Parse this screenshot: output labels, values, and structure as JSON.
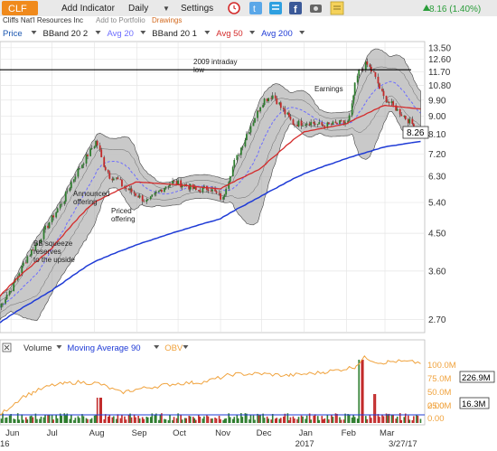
{
  "toolbar": {
    "ticker": "CLF",
    "add_indicator": "Add Indicator",
    "interval": "Daily",
    "settings": "Settings",
    "right_text": "8.16 (1.40%)",
    "colors": {
      "bg": "#e9e9e9",
      "ticker_bg": "#f08a1c",
      "green": "#2a9d3a"
    }
  },
  "subbar": {
    "company": "Cliffs Nat'l Resources Inc",
    "add_to_portfolio": "Add to Portfolio",
    "drawings": "Drawings"
  },
  "legend": {
    "items": [
      {
        "label": "Price",
        "color": "#1a56b0"
      },
      {
        "label": "BBand 20 2",
        "color": "#222222"
      },
      {
        "label": "Avg 20",
        "color": "#6d6dff"
      },
      {
        "label": "BBand 20 1",
        "color": "#222222"
      },
      {
        "label": "Avg 50",
        "color": "#d42b2b"
      },
      {
        "label": "Avg 200",
        "color": "#1f3bd6"
      }
    ]
  },
  "annotations": {
    "intraday": "2009 intraday\nlow",
    "earnings": "Earnings",
    "announced": "Announced\noffering",
    "priced": "Priced\noffering",
    "bb_squeeze": "BB squeeze\nreserves\nto the upside"
  },
  "chart_data": [
    {
      "type": "candlestick",
      "title": "CLF",
      "y_scale": "log",
      "ylim": [
        2.5,
        14.0
      ],
      "y_ticks": [
        "13.50",
        "12.60",
        "11.70",
        "10.80",
        "9.90",
        "9.00",
        "8.10",
        "7.20",
        "6.30",
        "5.40",
        "4.50",
        "3.60",
        "2.70"
      ],
      "y_tick_values": [
        13.5,
        12.6,
        11.7,
        10.8,
        9.9,
        9.0,
        8.1,
        7.2,
        6.3,
        5.4,
        4.5,
        3.6,
        2.7
      ],
      "x_tick_labels": [
        "Jun",
        "Jul",
        "Aug",
        "Sep",
        "Oct",
        "Nov",
        "Dec",
        "Jan",
        "Feb",
        "Mar"
      ],
      "x_tick_dates": [
        "2016-06-01",
        "2016-07-01",
        "2016-08-01",
        "2016-09-01",
        "2016-10-01",
        "2016-11-01",
        "2016-12-01",
        "2017-01-01",
        "2017-02-01",
        "2017-03-01"
      ],
      "x_range": [
        "2016-05-24",
        "2017-03-30"
      ],
      "year_labels": [
        "16",
        "2017"
      ],
      "end_date_label": "3/27/17",
      "last_price_label": "8.26",
      "last_price": 8.26,
      "horizontal_line": 11.85,
      "price_path": [
        [
          "2016-05-24",
          2.9
        ],
        [
          "2016-06-03",
          3.3
        ],
        [
          "2016-06-13",
          3.9
        ],
        [
          "2016-06-22",
          4.3
        ],
        [
          "2016-07-01",
          4.9
        ],
        [
          "2016-07-10",
          5.5
        ],
        [
          "2016-07-20",
          6.5
        ],
        [
          "2016-07-29",
          7.3
        ],
        [
          "2016-08-03",
          7.8
        ],
        [
          "2016-08-08",
          6.8
        ],
        [
          "2016-08-13",
          6.3
        ],
        [
          "2016-08-18",
          6.2
        ],
        [
          "2016-08-23",
          5.9
        ],
        [
          "2016-08-31",
          5.7
        ],
        [
          "2016-09-09",
          5.4
        ],
        [
          "2016-09-18",
          5.8
        ],
        [
          "2016-09-27",
          6.1
        ],
        [
          "2016-10-06",
          6.0
        ],
        [
          "2016-10-15",
          5.8
        ],
        [
          "2016-10-24",
          5.9
        ],
        [
          "2016-11-03",
          5.5
        ],
        [
          "2016-11-10",
          6.6
        ],
        [
          "2016-11-18",
          7.7
        ],
        [
          "2016-11-26",
          8.9
        ],
        [
          "2016-12-03",
          9.9
        ],
        [
          "2016-12-10",
          10.2
        ],
        [
          "2016-12-17",
          9.3
        ],
        [
          "2016-12-25",
          8.6
        ],
        [
          "2017-01-05",
          8.7
        ],
        [
          "2017-01-15",
          8.5
        ],
        [
          "2017-01-25",
          8.6
        ],
        [
          "2017-02-03",
          8.7
        ],
        [
          "2017-02-10",
          11.6
        ],
        [
          "2017-02-16",
          12.3
        ],
        [
          "2017-02-21",
          11.6
        ],
        [
          "2017-02-28",
          10.1
        ],
        [
          "2017-03-07",
          9.6
        ],
        [
          "2017-03-14",
          9.1
        ],
        [
          "2017-03-21",
          8.6
        ],
        [
          "2017-03-27",
          8.26
        ]
      ],
      "ma200_path": [
        [
          "2016-05-24",
          2.65
        ],
        [
          "2016-07-01",
          3.2
        ],
        [
          "2016-08-01",
          3.8
        ],
        [
          "2016-09-01",
          4.2
        ],
        [
          "2016-10-01",
          4.55
        ],
        [
          "2016-11-01",
          4.9
        ],
        [
          "2016-12-01",
          5.6
        ],
        [
          "2017-01-01",
          6.4
        ],
        [
          "2017-02-01",
          7.0
        ],
        [
          "2017-03-01",
          7.5
        ],
        [
          "2017-03-27",
          7.75
        ]
      ],
      "ma50_path": [
        [
          "2016-05-24",
          3.1
        ],
        [
          "2016-07-01",
          4.1
        ],
        [
          "2016-08-01",
          5.4
        ],
        [
          "2016-09-01",
          6.1
        ],
        [
          "2016-10-01",
          6.0
        ],
        [
          "2016-11-01",
          5.85
        ],
        [
          "2016-12-01",
          6.6
        ],
        [
          "2017-01-01",
          8.2
        ],
        [
          "2017-02-01",
          8.6
        ],
        [
          "2017-03-01",
          9.6
        ],
        [
          "2017-03-27",
          9.4
        ]
      ]
    },
    {
      "type": "line",
      "title": "Volume / OBV",
      "series": [
        {
          "name": "Volume",
          "color": "#333333"
        },
        {
          "name": "Moving Average 90",
          "color": "#1f3bd6"
        },
        {
          "name": "OBV",
          "color": "#f0a23c"
        }
      ],
      "left_ticks": [
        "100.0M",
        "75.0M",
        "50.0M",
        "25.0M"
      ],
      "right_ticks": [
        "0.00",
        "0.00"
      ],
      "last_values": {
        "obv": "226.9M",
        "ma": "16.3M"
      },
      "obv_path": [
        [
          "2016-05-24",
          8
        ],
        [
          "2016-06-10",
          38
        ],
        [
          "2016-07-01",
          55
        ],
        [
          "2016-07-20",
          60
        ],
        [
          "2016-08-05",
          58
        ],
        [
          "2016-08-20",
          44
        ],
        [
          "2016-09-10",
          52
        ],
        [
          "2016-10-01",
          58
        ],
        [
          "2016-10-20",
          60
        ],
        [
          "2016-11-10",
          72
        ],
        [
          "2016-12-01",
          73
        ],
        [
          "2016-12-20",
          70
        ],
        [
          "2017-01-10",
          74
        ],
        [
          "2017-01-25",
          78
        ],
        [
          "2017-02-08",
          84
        ],
        [
          "2017-02-15",
          98
        ],
        [
          "2017-02-25",
          90
        ],
        [
          "2017-03-10",
          92
        ],
        [
          "2017-03-27",
          90
        ]
      ]
    }
  ]
}
